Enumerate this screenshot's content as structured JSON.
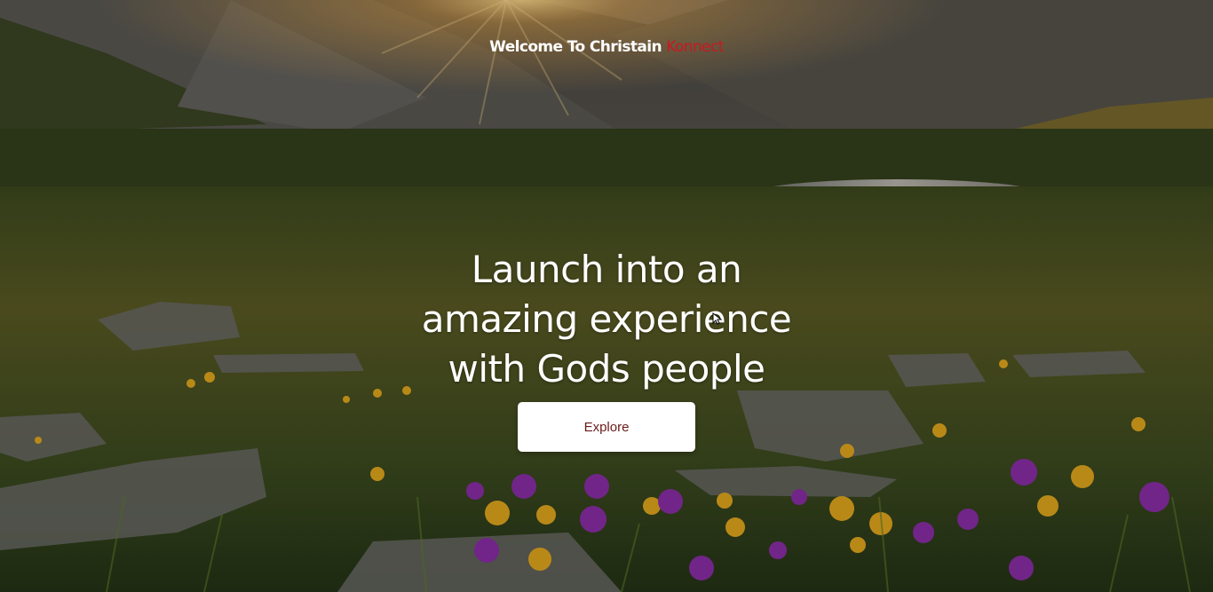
{
  "header": {
    "title_main": "Welcome To Christain ",
    "title_accent": "Konnect",
    "accent_color": "#c8191f"
  },
  "hero": {
    "headline_lines": [
      "Launch into an",
      "amazing experience",
      "with Gods people"
    ],
    "background_description_icon": "mountain-meadow-sunrise-image",
    "cta_label": "Explore",
    "cta_text_color": "#6b1a1a"
  }
}
